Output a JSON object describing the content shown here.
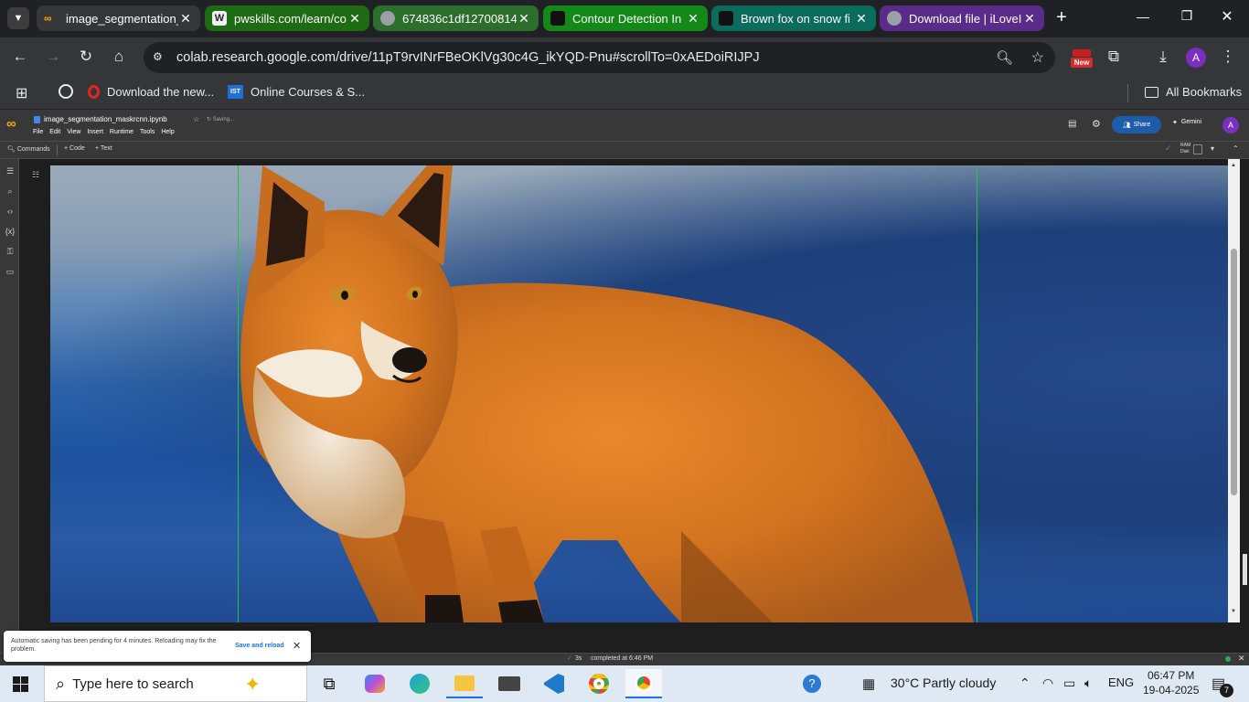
{
  "browser": {
    "tabs": [
      {
        "title": "image_segmentation_",
        "icon": "colab-icon",
        "active": true
      },
      {
        "title": "pwskills.com/learn/co",
        "icon": "wordpress-icon",
        "active": false,
        "color": "#1e6b13"
      },
      {
        "title": "674836c1df12700814",
        "icon": "globe-icon",
        "active": false,
        "color": "#2c6f2c"
      },
      {
        "title": "Contour Detection In",
        "icon": "learnopencv-icon",
        "active": false,
        "color": "#138a18"
      },
      {
        "title": "Brown fox on snow fi",
        "icon": "unsplash-icon",
        "active": false,
        "color": "#0b6b5c"
      },
      {
        "title": "Download file | iLoveI",
        "icon": "globe-icon",
        "active": false,
        "color": "#5a2c8a"
      }
    ],
    "url": "colab.research.google.com/drive/11pT9rvINrFBeOKlVg30c4G_ikYQD-Pnu#scrollTo=0xAEDoiRIJPJ",
    "new_badge": "New",
    "profile_initial": "A",
    "bookmarks": [
      {
        "label": "Download the new...",
        "icon": "opera-icon"
      },
      {
        "label": "Online Courses & S...",
        "icon": "ist-icon"
      }
    ],
    "ist_badge": "IST",
    "all_bookmarks": "All Bookmarks"
  },
  "colab": {
    "notebook_name": "image_segmentation_maskrcnn.ipynb",
    "saving_text": "Saving...",
    "menu": [
      "File",
      "Edit",
      "View",
      "Insert",
      "Runtime",
      "Tools",
      "Help"
    ],
    "share_label": "Share",
    "gemini_label": "Gemini",
    "commands_label": "Commands",
    "code_label": "+ Code",
    "text_label": "+ Text",
    "ram_label": "RAM",
    "disk_label": "Disk",
    "status_time": "3s",
    "status_text": "completed at 6:46 PM"
  },
  "toast": {
    "message": "Automatic saving has been pending for 4 minutes. Reloading may fix the problem.",
    "action": "Save and reload"
  },
  "taskbar": {
    "search_placeholder": "Type here to search",
    "weather": "30°C  Partly cloudy",
    "language": "ENG",
    "time": "06:47 PM",
    "date": "19-04-2025",
    "notification_count": "7"
  }
}
